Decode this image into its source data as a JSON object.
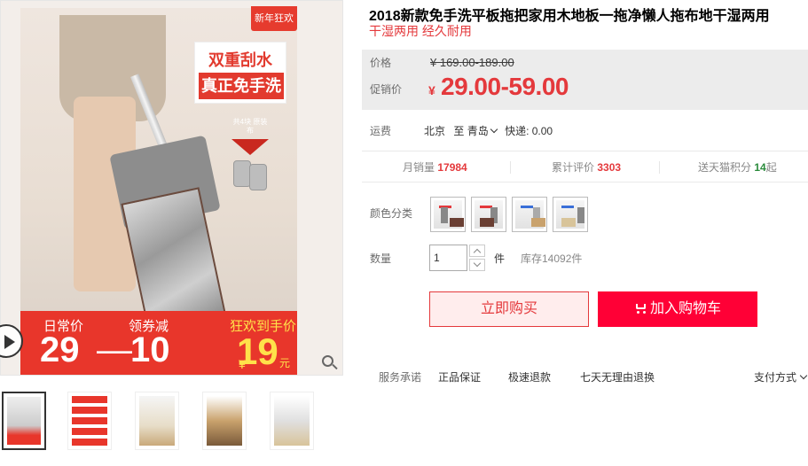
{
  "gallery": {
    "badge": "新年狂欢",
    "slogan_line1": "双重刮水",
    "slogan_line2": "真正免手洗",
    "pads_note": "共4块 原装布",
    "band": {
      "daily_label": "日常价",
      "daily_value": "29",
      "coupon_label": "领券减",
      "coupon_value": "10",
      "final_label": "狂欢到手价",
      "final_yen": "¥",
      "final_value": "19",
      "final_unit": "元"
    }
  },
  "product": {
    "title": "2018新款免手洗平板拖把家用木地板一拖净懒人拖布地干湿两用",
    "subtitle": "干湿两用 经久耐用"
  },
  "price": {
    "original_label": "价格",
    "original_value": "¥ 169.00-189.00",
    "promo_label": "促销价",
    "promo_yen": "¥",
    "promo_value": "29.00-59.00"
  },
  "shipping": {
    "label": "运费",
    "origin": "北京",
    "to": "至",
    "destination": "青岛",
    "express": "快递: 0.00"
  },
  "stats": {
    "monthly_sales_label": "月销量",
    "monthly_sales_value": "17984",
    "reviews_label": "累计评价",
    "reviews_value": "3303",
    "points_prefix": "送天猫积分",
    "points_value": "14",
    "points_suffix": "起"
  },
  "options": {
    "color_label": "颜色分类",
    "quantity_label": "数量",
    "quantity_value": "1",
    "quantity_unit": "件",
    "stock": "库存14092件"
  },
  "actions": {
    "buy_now": "立即购买",
    "add_to_cart": "加入购物车"
  },
  "service": {
    "label": "服务承诺",
    "items": [
      "正品保证",
      "极速退款",
      "七天无理由退换"
    ],
    "payment": "支付方式"
  },
  "colors": {
    "accent_red": "#e4393c",
    "tmall_red": "#ff0036",
    "price_bg": "#ececec"
  }
}
